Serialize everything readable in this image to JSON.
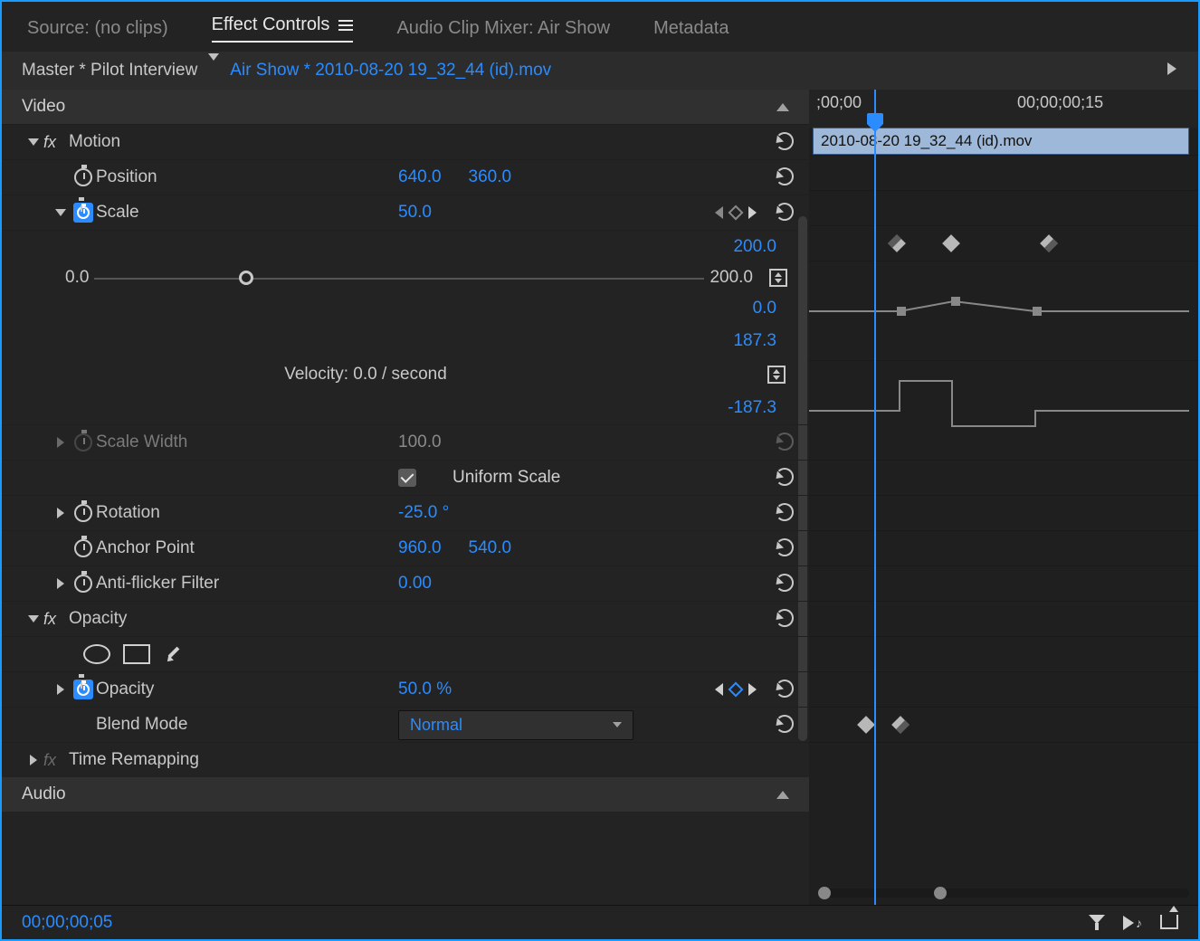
{
  "tabs": {
    "source": "Source: (no clips)",
    "effect_controls": "Effect Controls",
    "audio_mixer": "Audio Clip Mixer: Air Show",
    "metadata": "Metadata"
  },
  "subheader": {
    "master": "Master * Pilot Interview",
    "clip": "Air Show * 2010-08-20 19_32_44 (id).mov"
  },
  "sections": {
    "video": "Video",
    "audio": "Audio"
  },
  "effects": {
    "motion": {
      "label": "Motion",
      "position": {
        "label": "Position",
        "x": "640.0",
        "y": "360.0"
      },
      "scale": {
        "label": "Scale",
        "value": "50.0",
        "max_label": "200.0",
        "min_label": "0.0",
        "slider_min": "0.0",
        "slider_max": "200.0",
        "velocity_label": "Velocity: 0.0 / second",
        "vel_max": "187.3",
        "vel_min": "-187.3"
      },
      "scale_width": {
        "label": "Scale Width",
        "value": "100.0"
      },
      "uniform_scale": {
        "label": "Uniform Scale",
        "checked": true
      },
      "rotation": {
        "label": "Rotation",
        "value": "-25.0 °"
      },
      "anchor": {
        "label": "Anchor Point",
        "x": "960.0",
        "y": "540.0"
      },
      "antiflicker": {
        "label": "Anti-flicker Filter",
        "value": "0.00"
      }
    },
    "opacity": {
      "label": "Opacity",
      "value_label": "Opacity",
      "value": "50.0 %",
      "blend_label": "Blend Mode",
      "blend_value": "Normal"
    },
    "time_remapping": {
      "label": "Time Remapping"
    }
  },
  "timeline": {
    "tc0": ";00;00",
    "tc1": "00;00;00;15",
    "clip_name": "2010-08-20 19_32_44 (id).mov"
  },
  "footer": {
    "timecode": "00;00;00;05"
  }
}
